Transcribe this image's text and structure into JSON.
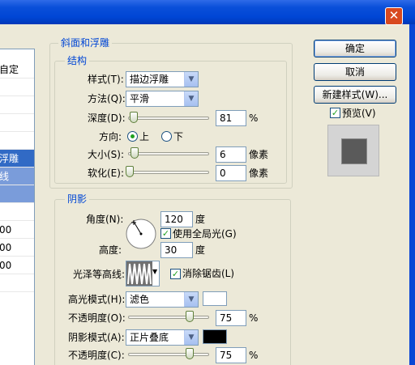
{
  "title_bar": {
    "close_glyph": "✕"
  },
  "styles_panel": {
    "items": [
      "自定",
      "",
      "",
      "",
      "",
      "浮雕",
      "线",
      "",
      "",
      "00",
      "00",
      "00",
      ""
    ]
  },
  "bevel": {
    "group_title": "斜面和浮雕",
    "structure_title": "结构",
    "style": {
      "label": "样式(T):",
      "value": "描边浮雕"
    },
    "technique": {
      "label": "方法(Q):",
      "value": "平滑"
    },
    "depth": {
      "label": "深度(D):",
      "value": "81",
      "unit": "%"
    },
    "direction": {
      "label": "方向:",
      "up": "上",
      "down": "下",
      "selected": "up"
    },
    "size": {
      "label": "大小(S):",
      "value": "6",
      "unit": "像素"
    },
    "soften": {
      "label": "软化(E):",
      "value": "0",
      "unit": "像素"
    }
  },
  "shading": {
    "group_title": "阴影",
    "angle": {
      "label": "角度(N):",
      "value": "120",
      "unit": "度"
    },
    "global_light": {
      "label": "使用全局光(G)",
      "checked": true
    },
    "altitude": {
      "label": "高度:",
      "value": "30",
      "unit": "度"
    },
    "gloss_contour": {
      "label": "光泽等高线:"
    },
    "anti_aliased": {
      "label": "消除锯齿(L)",
      "checked": true
    },
    "highlight_mode": {
      "label": "高光模式(H):",
      "value": "滤色",
      "color": "#FFFFFF"
    },
    "highlight_opacity": {
      "label": "不透明度(O):",
      "value": "75",
      "unit": "%"
    },
    "shadow_mode": {
      "label": "阴影模式(A):",
      "value": "正片叠底",
      "color": "#000000"
    },
    "shadow_opacity": {
      "label": "不透明度(C):",
      "value": "75",
      "unit": "%"
    }
  },
  "buttons": {
    "ok": "确定",
    "cancel": "取消",
    "new_style": "新建样式(W)...",
    "preview": "预览(V)"
  },
  "preview_checked": true,
  "colors": {
    "titlebar": "#0046D5",
    "selection": "#316AC5",
    "group_title": "#0046D5",
    "dialog_bg": "#ECE9D8"
  }
}
